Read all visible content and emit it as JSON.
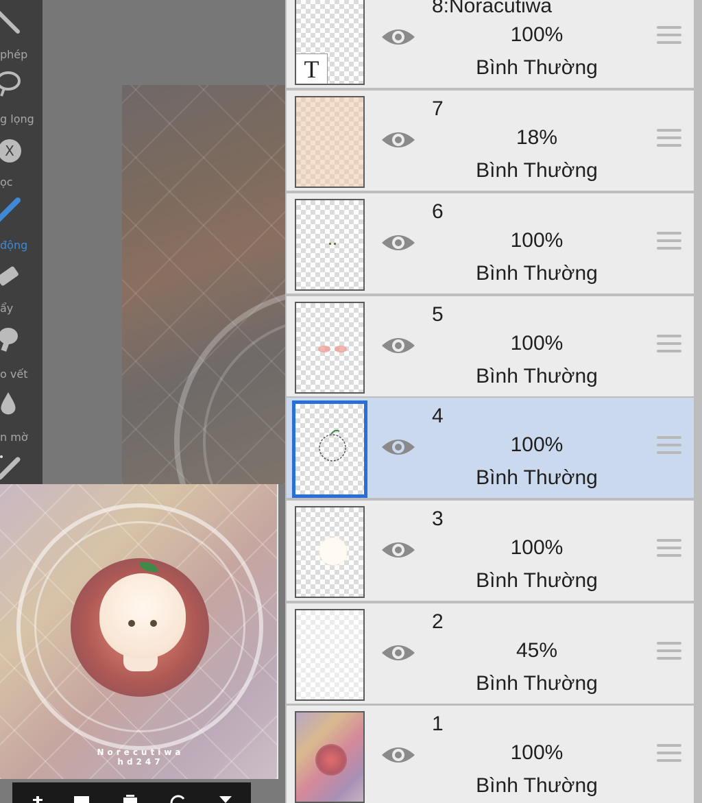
{
  "tools": [
    {
      "name": "magic-wand",
      "label": "phép",
      "icon": "magic-wand-icon",
      "active": false
    },
    {
      "name": "lasso",
      "label": "g lọng",
      "icon": "lasso-icon",
      "active": false
    },
    {
      "name": "filter",
      "label": "ọc",
      "icon": "x-circle-icon",
      "active": false
    },
    {
      "name": "brush",
      "label": "động",
      "icon": "brush-icon",
      "active": true
    },
    {
      "name": "eraser",
      "label": "ẩy",
      "icon": "eraser-icon",
      "active": false
    },
    {
      "name": "smudge",
      "label": "o vết",
      "icon": "smudge-icon",
      "active": false
    },
    {
      "name": "blur",
      "label": "n mờ",
      "icon": "blur-drop-icon",
      "active": false
    }
  ],
  "preview": {
    "watermark_line1": "Norecutiwa",
    "watermark_line2": "hd247"
  },
  "layers": [
    {
      "name": "8:Noracutiwa",
      "opacity": "100%",
      "blend": "Bình Thường",
      "selected": false,
      "thumb": "text"
    },
    {
      "name": "7",
      "opacity": "18%",
      "blend": "Bình Thường",
      "selected": false,
      "thumb": "peach"
    },
    {
      "name": "6",
      "opacity": "100%",
      "blend": "Bình Thường",
      "selected": false,
      "thumb": "dots"
    },
    {
      "name": "5",
      "opacity": "100%",
      "blend": "Bình Thường",
      "selected": false,
      "thumb": "blush"
    },
    {
      "name": "4",
      "opacity": "100%",
      "blend": "Bình Thường",
      "selected": true,
      "thumb": "outline"
    },
    {
      "name": "3",
      "opacity": "100%",
      "blend": "Bình Thường",
      "selected": false,
      "thumb": "white-blob"
    },
    {
      "name": "2",
      "opacity": "45%",
      "blend": "Bình Thường",
      "selected": false,
      "thumb": "faint"
    },
    {
      "name": "1",
      "opacity": "100%",
      "blend": "Bình Thường",
      "selected": false,
      "thumb": "photo"
    }
  ],
  "colors": {
    "accent": "#2a6fd6",
    "selected_row": "#cbd9ee",
    "row": "#ececec",
    "toolbar": "#3f3f3f",
    "active_tool": "#3e8ad6"
  }
}
